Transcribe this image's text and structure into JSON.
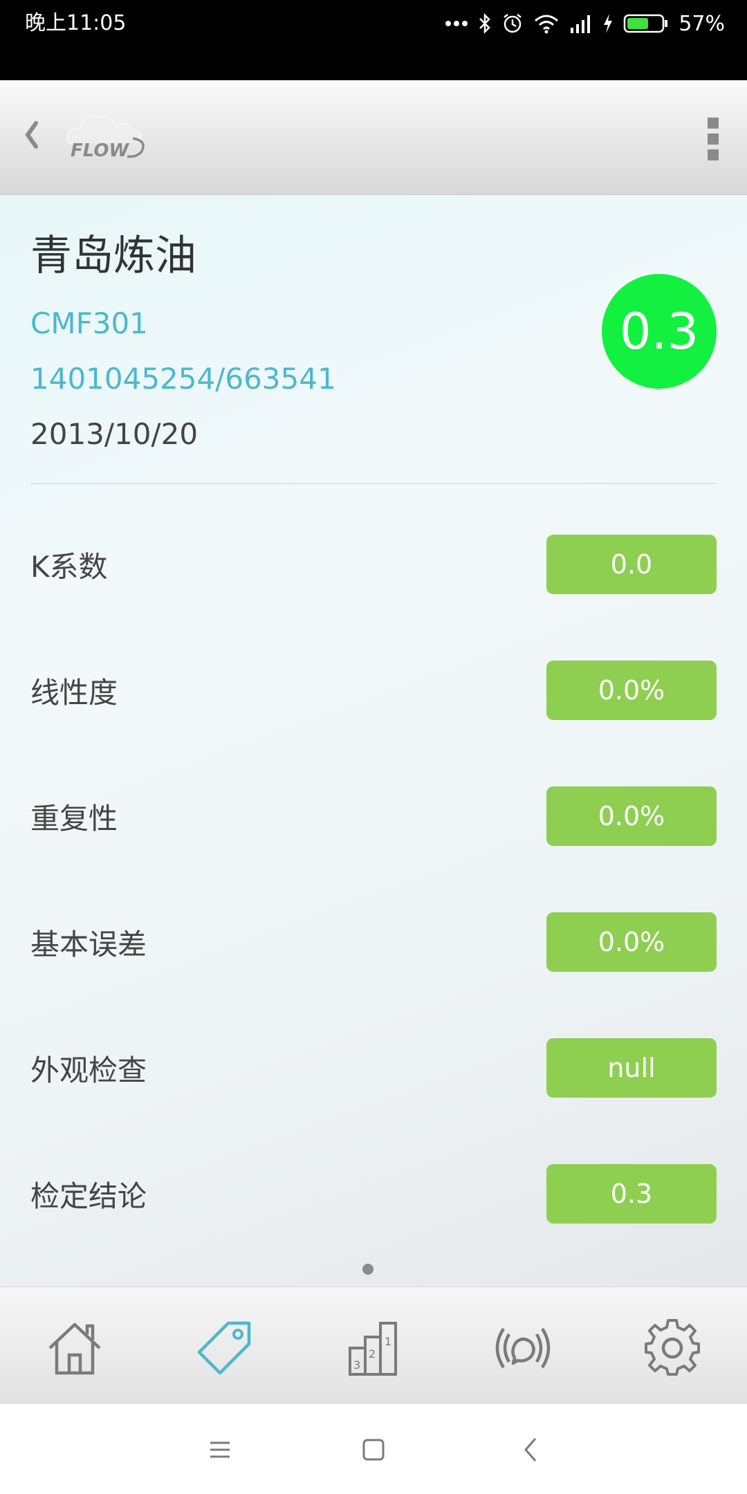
{
  "status_bar": {
    "time": "晚上11:05",
    "battery": "57%",
    "icons": [
      "more-dots-icon",
      "bluetooth-icon",
      "alarm-icon",
      "wifi-icon",
      "signal-icon",
      "charging-icon",
      "battery-icon"
    ]
  },
  "app_bar": {
    "logo_text": "FLOW",
    "icons": [
      "back-icon",
      "flow-logo",
      "overflow-menu-icon"
    ]
  },
  "meter": {
    "name": "青岛炼油",
    "model": "CMF301",
    "serial": "1401045254/663541",
    "date": "2013/10/20",
    "score": "0.3"
  },
  "rows": [
    {
      "label": "K系数",
      "value": "0.0"
    },
    {
      "label": "线性度",
      "value": "0.0%"
    },
    {
      "label": "重复性",
      "value": "0.0%"
    },
    {
      "label": "基本误差",
      "value": "0.0%"
    },
    {
      "label": "外观检查",
      "value": "null"
    },
    {
      "label": "检定结论",
      "value": "0.3"
    }
  ],
  "tab_bar": {
    "tabs": [
      "home-icon",
      "tag-icon",
      "ranking-icon",
      "broadcast-icon",
      "settings-icon"
    ],
    "active": "tag-icon"
  },
  "nav_bar": {
    "buttons": [
      "menu-icon",
      "home-square-icon",
      "back-arrow-icon"
    ]
  },
  "colors": {
    "accent": "#4cb8cc",
    "badge": "#12f040",
    "value_bg": "#8ecf52"
  }
}
